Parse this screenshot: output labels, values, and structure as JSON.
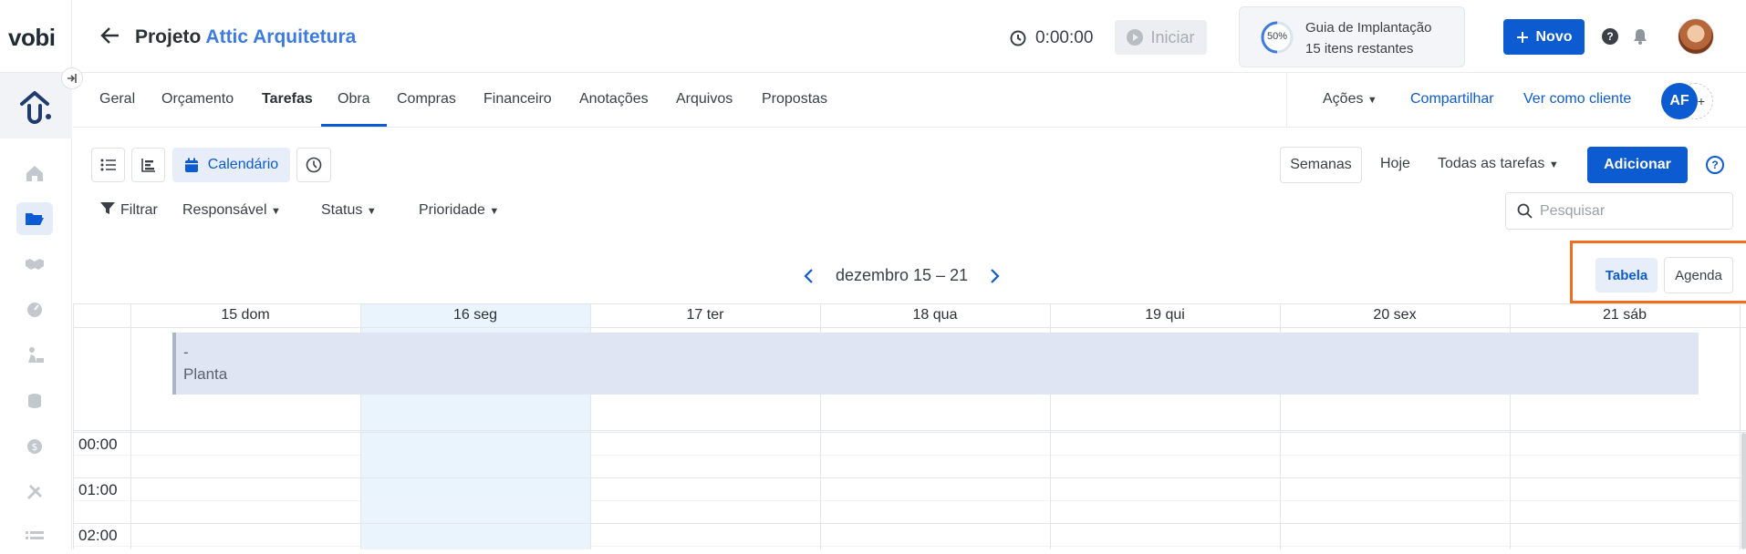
{
  "app": {
    "logo": "vobi"
  },
  "header": {
    "project_prefix": "Projeto",
    "project_name": "Attic Arquitetura",
    "timer": "0:00:00",
    "start_label": "Iniciar",
    "guide": {
      "percent": "50%",
      "title": "Guia de Implantação",
      "subtitle": "15 itens restantes"
    },
    "new_label": "Novo"
  },
  "tabs": [
    "Geral",
    "Orçamento",
    "Tarefas",
    "Obra",
    "Compras",
    "Financeiro",
    "Anotações",
    "Arquivos",
    "Propostas"
  ],
  "active_tab": "Tarefas",
  "tabs_right": {
    "actions": "Ações",
    "share": "Compartilhar",
    "view_as_client": "Ver como cliente",
    "user_initials": "AF",
    "add": "+"
  },
  "toolbar": {
    "calendar_label": "Calendário",
    "weeks_label": "Semanas",
    "today_label": "Hoje",
    "all_tasks_label": "Todas as tarefas",
    "add_label": "Adicionar"
  },
  "filters": {
    "filter_label": "Filtrar",
    "responsible": "Responsável",
    "status": "Status",
    "priority": "Prioridade"
  },
  "search": {
    "placeholder": "Pesquisar"
  },
  "calendar": {
    "range_label": "dezembro 15 – 21",
    "view_table": "Tabela",
    "view_agenda": "Agenda",
    "days": [
      "15 dom",
      "16 seg",
      "17 ter",
      "18 qua",
      "19 qui",
      "20 sex",
      "21 sáb"
    ],
    "event": {
      "line1": "-",
      "line2": "Planta"
    },
    "hours": [
      "00:00",
      "01:00",
      "02:00"
    ]
  },
  "colors": {
    "primary": "#0d5bd1",
    "link": "#3d7be0",
    "highlight": "#ef6f1f",
    "today_column": "#e9f4fd",
    "event_bg": "#dfe5f3"
  }
}
